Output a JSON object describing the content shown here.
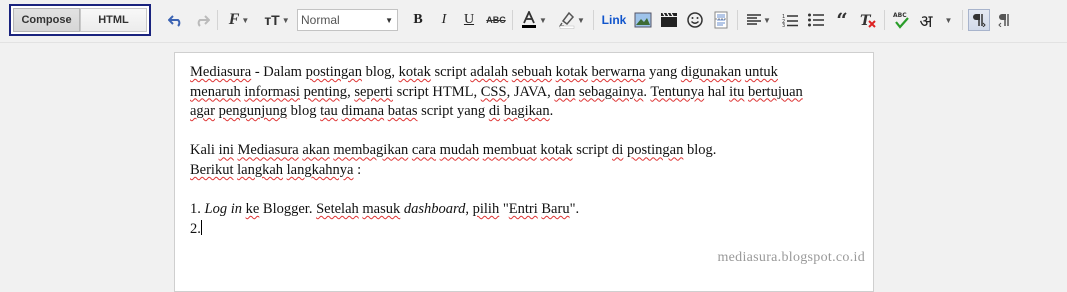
{
  "mode_tabs": {
    "compose_label": "Compose",
    "html_label": "HTML",
    "active": "Compose"
  },
  "toolbar": {
    "font_size_label": "тT",
    "paragraph_format": "Normal",
    "link_label": "Link",
    "transliterate_glyph": "अ",
    "icons": [
      "undo-icon",
      "redo-icon",
      "font-family-icon",
      "font-size-icon",
      "bold-icon",
      "italic-icon",
      "underline-icon",
      "strikethrough-icon",
      "text-color-icon",
      "highlight-color-icon",
      "image-icon",
      "video-icon",
      "emoji-icon",
      "jump-break-icon",
      "align-icon",
      "numbered-list-icon",
      "bulleted-list-icon",
      "quote-icon",
      "clear-formatting-icon",
      "spell-check-icon",
      "transliterate-icon",
      "ltr-icon",
      "rtl-icon"
    ],
    "accent_color": "#1a237e",
    "link_color": "#1155cc"
  },
  "editor": {
    "paragraph1_line1": [
      "Mediasura",
      " - Dalam ",
      "postingan",
      " blog, ",
      "kotak",
      " script ",
      "adalah",
      " ",
      "sebuah",
      " ",
      "kotak",
      " ",
      "berwarna",
      " yang ",
      "digunakan",
      " ",
      "untuk"
    ],
    "paragraph1_line2": [
      "menaruh",
      " ",
      "informasi",
      " ",
      "penting",
      ", ",
      "seperti",
      " script HTML, ",
      "CSS",
      ", JAVA, ",
      "dan",
      " ",
      "sebagainya",
      ". ",
      "Tentunya",
      " hal ",
      "itu",
      " ",
      "bertujuan"
    ],
    "paragraph1_line3": [
      "agar",
      " ",
      "pengunjung",
      " blog ",
      "tau",
      " ",
      "dimana",
      " ",
      "batas",
      " script yang ",
      "di",
      " ",
      "bagikan",
      "."
    ],
    "paragraph2_line1": [
      "Kali",
      " ",
      "ini",
      " ",
      "Mediasura",
      " ",
      "akan",
      " ",
      "membagikan",
      " ",
      "cara",
      " ",
      "mudah",
      " ",
      "membuat",
      " ",
      "kotak",
      " script ",
      "di",
      " ",
      "postingan",
      " blog."
    ],
    "paragraph2_line2": [
      "Berikut",
      " ",
      "langkah",
      " ",
      "langkahnya",
      " :"
    ],
    "step1": {
      "prefix": "1. ",
      "login": "Log in",
      "text1": " ",
      "ke": "ke",
      "text2": " Blogger. ",
      "setelah": "Setelah",
      "text3": " ",
      "masuk": "masuk",
      "text4": " ",
      "dashboard": "dashboard",
      "text5": ", ",
      "pilih": "pilih",
      "text6": " \"",
      "entri": "Entri",
      "text7": " ",
      "baru": "Baru",
      "text8": "\"."
    },
    "step2": "2.",
    "watermark": "mediasura.blogspot.co.id"
  }
}
